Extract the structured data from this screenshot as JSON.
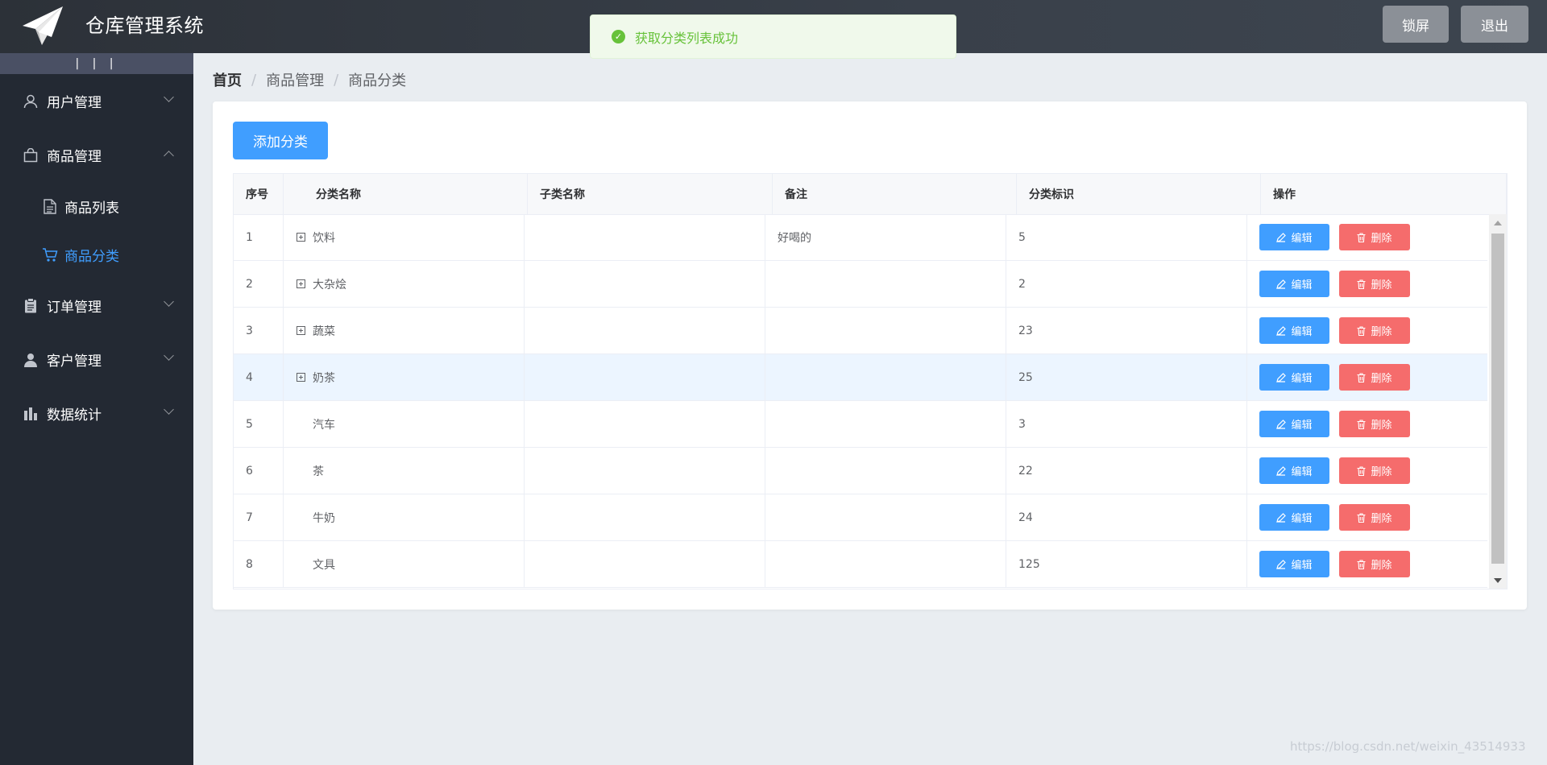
{
  "header": {
    "title": "仓库管理系统",
    "logo_icon": "paper-plane-icon",
    "lock_label": "锁屏",
    "logout_label": "退出"
  },
  "toast": {
    "message": "获取分类列表成功",
    "icon": "success-check-icon",
    "color": "#67c23a"
  },
  "sidebar": {
    "collapse_label": "| | |",
    "items": [
      {
        "label": "用户管理",
        "icon": "user-icon",
        "expanded": false
      },
      {
        "label": "商品管理",
        "icon": "shopping-bag-icon",
        "expanded": true,
        "children": [
          {
            "label": "商品列表",
            "icon": "document-icon",
            "active": false
          },
          {
            "label": "商品分类",
            "icon": "shopping-cart-icon",
            "active": true
          }
        ]
      },
      {
        "label": "订单管理",
        "icon": "clipboard-icon",
        "expanded": false
      },
      {
        "label": "客户管理",
        "icon": "customer-icon",
        "expanded": false
      },
      {
        "label": "数据统计",
        "icon": "bar-chart-icon",
        "expanded": false
      }
    ]
  },
  "breadcrumb": [
    "首页",
    "商品管理",
    "商品分类"
  ],
  "main": {
    "add_button_label": "添加分类",
    "table": {
      "headers": [
        "序号",
        "分类名称",
        "子类名称",
        "备注",
        "分类标识",
        "操作"
      ],
      "rows": [
        {
          "index": "1",
          "name": "饮料",
          "subname": "",
          "remark": "好喝的",
          "tag": "5",
          "expandable": true
        },
        {
          "index": "2",
          "name": "大杂烩",
          "subname": "",
          "remark": "",
          "tag": "2",
          "expandable": true
        },
        {
          "index": "3",
          "name": "蔬菜",
          "subname": "",
          "remark": "",
          "tag": "23",
          "expandable": true
        },
        {
          "index": "4",
          "name": "奶茶",
          "subname": "",
          "remark": "",
          "tag": "25",
          "expandable": true,
          "highlighted": true
        },
        {
          "index": "5",
          "name": "汽车",
          "subname": "",
          "remark": "",
          "tag": "3",
          "expandable": false
        },
        {
          "index": "6",
          "name": "茶",
          "subname": "",
          "remark": "",
          "tag": "22",
          "expandable": false
        },
        {
          "index": "7",
          "name": "牛奶",
          "subname": "",
          "remark": "",
          "tag": "24",
          "expandable": false
        },
        {
          "index": "8",
          "name": "文具",
          "subname": "",
          "remark": "",
          "tag": "125",
          "expandable": false
        }
      ],
      "edit_label": "编辑",
      "delete_label": "删除"
    }
  },
  "watermark": "https://blog.csdn.net/weixin_43514933",
  "colors": {
    "primary": "#409eff",
    "danger": "#f56c6c",
    "sidebar_bg": "#232933",
    "success": "#67c23a"
  }
}
